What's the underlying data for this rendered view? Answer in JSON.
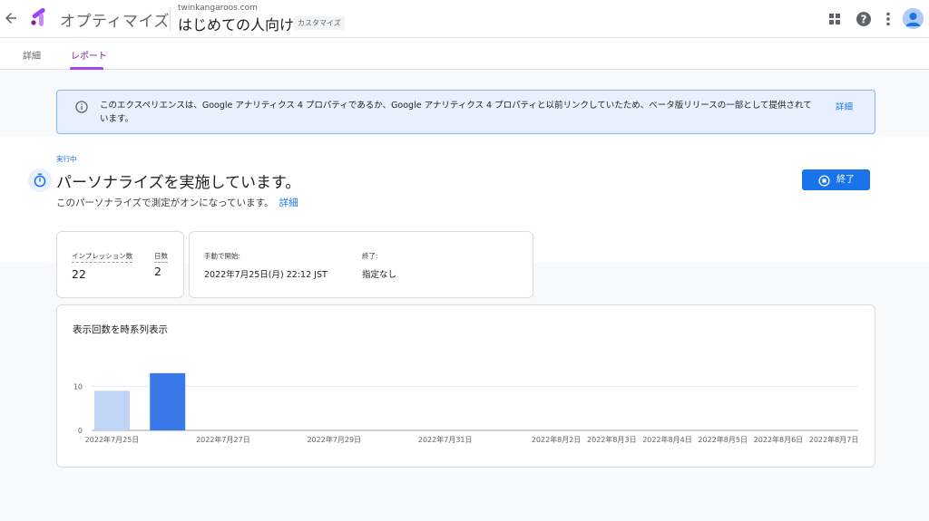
{
  "header": {
    "back_icon": "arrow-back-icon",
    "product_name": "オプティマイズ",
    "domain": "twinkangaroos.com",
    "experience_name": "はじめての人向け",
    "badge": "カスタマイズ",
    "icons": [
      "apps-grid-icon",
      "help-icon",
      "more-vert-icon",
      "account-avatar-icon"
    ]
  },
  "tabs": [
    {
      "label": "詳細",
      "active": false
    },
    {
      "label": "レポート",
      "active": true
    }
  ],
  "banner": {
    "icon": "info-icon",
    "text": "このエクスペリエンスは、Google アナリティクス 4 プロパティであるか、Google アナリティクス 4 プロパティと以前リンクしていたため、ベータ版リリースの一部として提供されています。",
    "link": "詳細"
  },
  "status": {
    "label": "実行中",
    "icon": "timer-icon",
    "title": "パーソナライズを実施しています。",
    "subtitle": "このパーソナライズで測定がオンになっています。",
    "subtitle_link": "詳細",
    "end_button": "終了"
  },
  "stats": {
    "impressions_label": "インプレッション数",
    "impressions_value": "22",
    "days_label": "日数",
    "days_value": "2",
    "start_label": "手動で開始:",
    "start_value": "2022年7月25日(月) 22:12 JST",
    "end_label": "終了:",
    "end_value": "指定なし"
  },
  "chart_title": "表示回数を時系列表示",
  "chart_data": {
    "type": "bar",
    "title": "表示回数を時系列表示",
    "xlabel": "",
    "ylabel": "",
    "ylim": [
      0,
      14
    ],
    "y_ticks": [
      0,
      10
    ],
    "grid": true,
    "categories": [
      "2022年7月25日",
      "2022年7月26日"
    ],
    "values": [
      9,
      13
    ],
    "colors": [
      "#c0d5f5",
      "#3b78e7"
    ],
    "x_tick_labels": [
      "2022年7月25日",
      "2022年7月27日",
      "2022年7月29日",
      "2022年7月31日",
      "2022年8月2日",
      "2022年8月3日",
      "2022年8月4日",
      "2022年8月5日",
      "2022年8月6日",
      "2022年8月7日"
    ],
    "x_tick_days": [
      0,
      2,
      4,
      6,
      8,
      9,
      10,
      11,
      12,
      13
    ]
  }
}
